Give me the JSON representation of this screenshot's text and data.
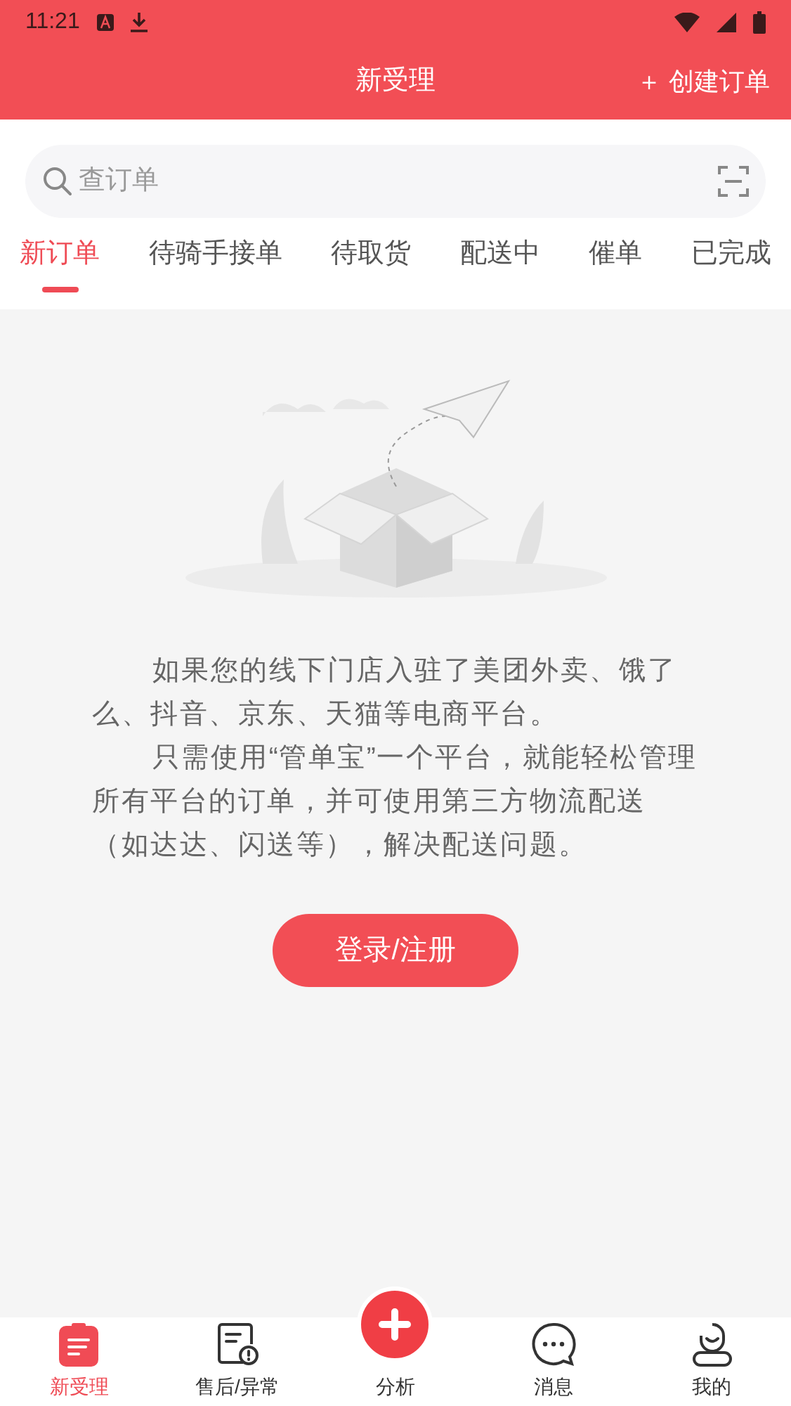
{
  "status_bar": {
    "time": "11:21"
  },
  "header": {
    "title": "新受理",
    "action": "＋ 创建订单"
  },
  "search": {
    "placeholder": "查订单"
  },
  "tabs": [
    {
      "label": "新订单",
      "selected": true
    },
    {
      "label": "待骑手接单",
      "selected": false
    },
    {
      "label": "待取货",
      "selected": false
    },
    {
      "label": "配送中",
      "selected": false
    },
    {
      "label": "催单",
      "selected": false
    },
    {
      "label": "已完成",
      "selected": false
    }
  ],
  "empty_state": {
    "paragraphs": [
      "如果您的线下门店入驻了美团外卖、饿了么、抖音、京东、天猫等电商平台。",
      "只需使用“管单宝”一个平台，就能轻松管理所有平台的订单，并可使用第三方物流配送（如达达、闪送等），解决配送问题。"
    ],
    "button": "登录/注册"
  },
  "bottom_nav": [
    {
      "label": "新受理",
      "selected": true,
      "kind": "tab"
    },
    {
      "label": "售后/异常",
      "selected": false,
      "kind": "tab"
    },
    {
      "label": "分析",
      "selected": false,
      "kind": "center"
    },
    {
      "label": "消息",
      "selected": false,
      "kind": "tab"
    },
    {
      "label": "我的",
      "selected": false,
      "kind": "tab"
    }
  ]
}
